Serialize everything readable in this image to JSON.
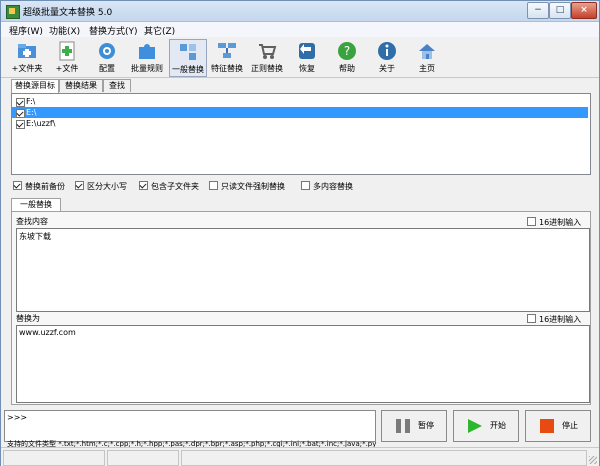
{
  "window": {
    "title": "超级批量文本替换 5.0",
    "min": "−",
    "max": "□",
    "close": "×"
  },
  "menu": [
    "程序(W)",
    "功能(X)",
    "替换方式(Y)",
    "其它(Z)"
  ],
  "toolbar": [
    {
      "label": "+文件夹",
      "icon": "folder-add-icon",
      "color": "#4a8fd9"
    },
    {
      "label": "+文件",
      "icon": "file-add-icon",
      "color": "#3fb049"
    },
    {
      "label": "配置",
      "icon": "gear-icon",
      "color": "#3c8ed8"
    },
    {
      "label": "批量规则",
      "icon": "puzzle-icon",
      "color": "#3f8fdc"
    },
    {
      "label": "一般替换",
      "icon": "replace-icon",
      "color": "#5b9ad8"
    },
    {
      "label": "特征替换",
      "icon": "feature-replace-icon",
      "color": "#5b9ad8"
    },
    {
      "label": "正则替换",
      "icon": "cart-icon",
      "color": "#606060"
    },
    {
      "label": "恢复",
      "icon": "restore-icon",
      "color": "#2f6ea8"
    },
    {
      "label": "帮助",
      "icon": "help-icon",
      "color": "#3aa33f"
    },
    {
      "label": "关于",
      "icon": "info-icon",
      "color": "#2f6ea8"
    },
    {
      "label": "主页",
      "icon": "home-icon",
      "color": "#4a82c6"
    }
  ],
  "tabs": [
    "替换源目标",
    "替换结果",
    "查找"
  ],
  "targets": [
    {
      "path": "F:\\",
      "checked": true,
      "selected": false
    },
    {
      "path": "E:\\",
      "checked": true,
      "selected": true
    },
    {
      "path": "E:\\uzzf\\",
      "checked": true,
      "selected": false
    }
  ],
  "options": [
    {
      "label": "替换前备份",
      "checked": true
    },
    {
      "label": "区分大小写",
      "checked": true
    },
    {
      "label": "包含子文件夹",
      "checked": true
    },
    {
      "label": "只读文件强制替换",
      "checked": false
    },
    {
      "label": "多内容替换",
      "checked": false
    }
  ],
  "replace": {
    "tab": "一般替换",
    "find_label": "查找内容",
    "find_value": "东坡下载",
    "replace_label": "替换为",
    "replace_value": "www.uzzf.com",
    "hex_label": "16进制输入"
  },
  "log": {
    "prompt": ">>>",
    "filetypes": "支持的文件类型 *.txt;*.htm;*.c;*.cpp;*.h;*.hpp;*.pas;*.dpr;*.bpr;*.asp;*.php;*.cgi;*.ini;*.bat;*.inc;*.java;*.py;*.dfm"
  },
  "actions": {
    "pause": "暂停",
    "start": "开始",
    "stop": "停止"
  },
  "colors": {
    "selection": "#3399ff",
    "start": "#2fb62f",
    "stop": "#e84b12"
  }
}
